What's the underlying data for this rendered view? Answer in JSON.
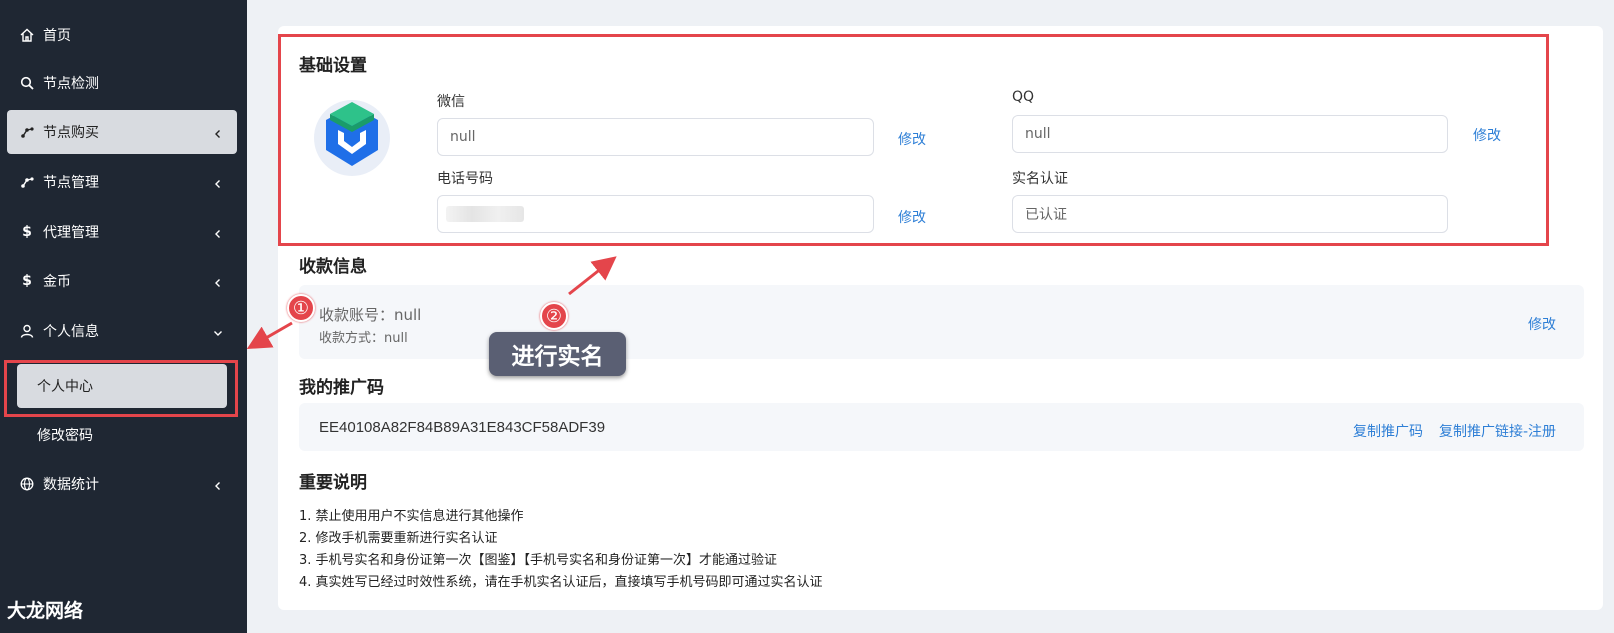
{
  "sidebar": {
    "items": [
      {
        "label": "首页",
        "icon": "home-icon"
      },
      {
        "label": "节点检测",
        "icon": "search-icon"
      },
      {
        "label": "节点购买",
        "icon": "node-icon"
      },
      {
        "label": "节点管理",
        "icon": "node-icon"
      },
      {
        "label": "代理管理",
        "icon": "dollar-icon"
      },
      {
        "label": "金币",
        "icon": "dollar-icon"
      },
      {
        "label": "个人信息",
        "icon": "user-icon"
      },
      {
        "label": "数据统计",
        "icon": "globe-icon"
      }
    ],
    "sub_items": [
      {
        "label": "个人中心"
      },
      {
        "label": "修改密码"
      }
    ],
    "brand": "大龙网络"
  },
  "basic": {
    "title": "基础设置",
    "wechat_label": "微信",
    "wechat_value": "null",
    "qq_label": "QQ",
    "qq_value": "null",
    "phone_label": "电话号码",
    "realname_label": "实名认证",
    "realname_value": "已认证",
    "edit": "修改"
  },
  "payment": {
    "title": "收款信息",
    "account": "收款账号：null",
    "method": "收款方式：null",
    "edit": "修改"
  },
  "promo": {
    "title": "我的推广码",
    "code": "EE40108A82F84B89A31E843CF58ADF39",
    "copy_code": "复制推广码",
    "copy_link": "复制推广链接-注册"
  },
  "notes": {
    "title": "重要说明",
    "items": [
      "1. 禁止使用用户不实信息进行其他操作",
      "2. 修改手机需要重新进行实名认证",
      "3. 手机号实名和身份证第一次【图鉴】【手机号实名和身份证第一次】才能通过验证",
      "4. 真实姓写已经过时效性系统，请在手机实名认证后，直接填写手机号码即可通过实名认证"
    ]
  },
  "annotations": {
    "step1": "①",
    "step2": "②",
    "label": "进行实名"
  },
  "colors": {
    "sidebar_bg": "#1f2733",
    "highlight_red": "#e4454b",
    "link_blue": "#2e7fd6"
  }
}
